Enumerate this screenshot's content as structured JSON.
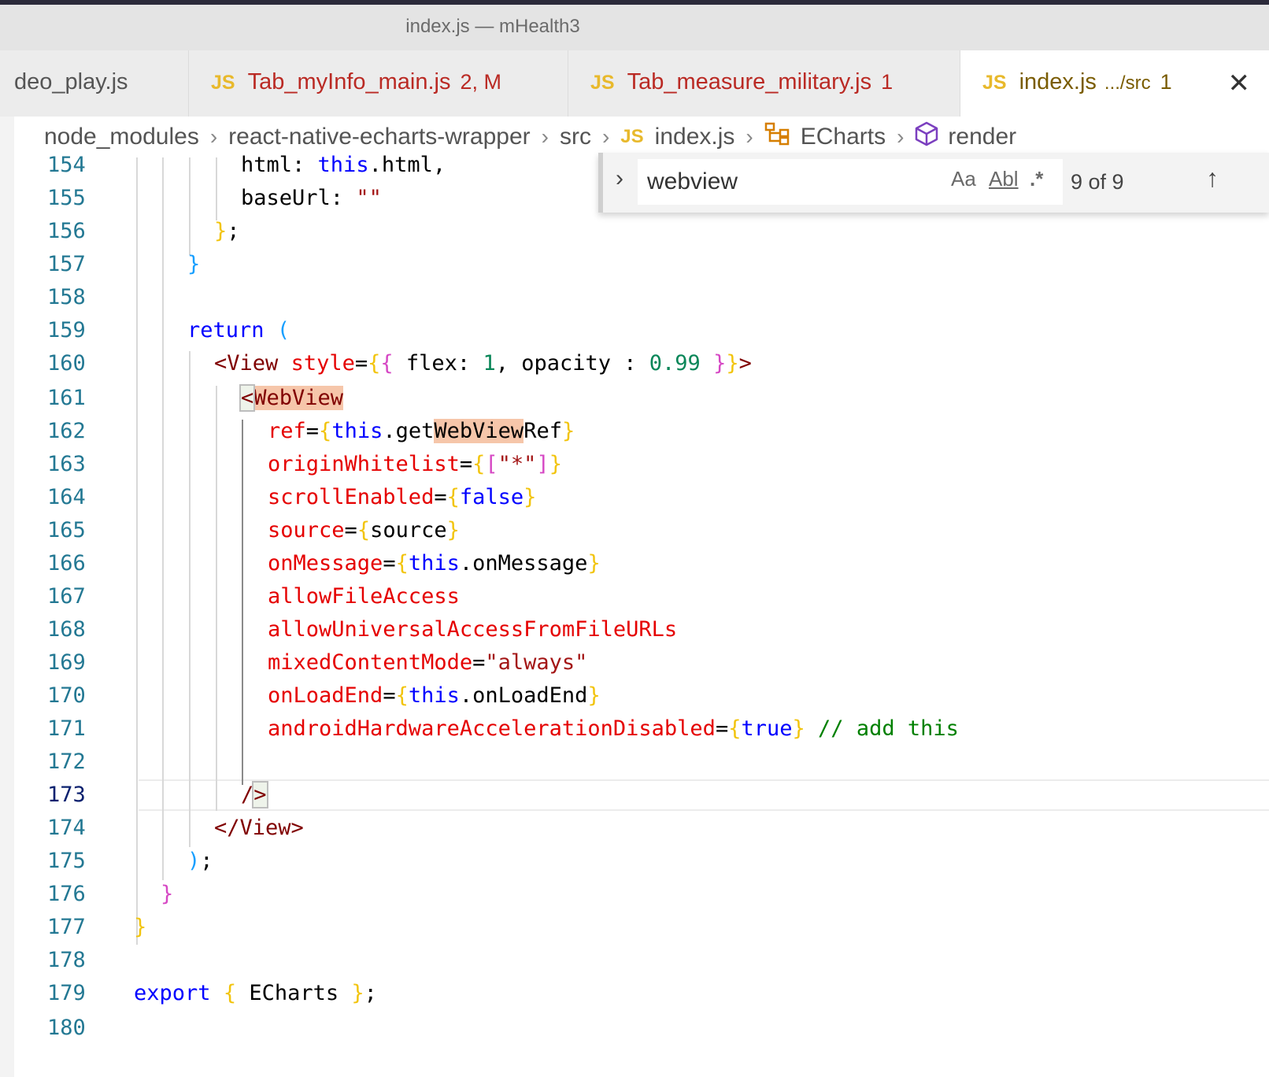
{
  "window": {
    "title": "index.js — mHealth3"
  },
  "tabs": [
    {
      "icon": "",
      "name": "deo_play.js",
      "badge": "",
      "path": ""
    },
    {
      "icon": "JS",
      "name": "Tab_myInfo_main.js",
      "badge": "2, M",
      "path": ""
    },
    {
      "icon": "JS",
      "name": "Tab_measure_military.js",
      "badge": "1",
      "path": ""
    },
    {
      "icon": "JS",
      "name": "index.js",
      "badge": "1",
      "path": ".../src"
    }
  ],
  "breadcrumb": {
    "items": [
      "node_modules",
      "react-native-echarts-wrapper",
      "src",
      "index.js",
      "ECharts",
      "render"
    ],
    "js_icon": "JS"
  },
  "find": {
    "value": "webview",
    "opt_case": "Aa",
    "opt_word": "Abl",
    "opt_regex": ".*",
    "count": "9 of 9"
  },
  "editor": {
    "current_line": "173",
    "line_numbers": [
      "154",
      "155",
      "156",
      "157",
      "158",
      "159",
      "160",
      "161",
      "162",
      "163",
      "164",
      "165",
      "166",
      "167",
      "168",
      "169",
      "170",
      "171",
      "172",
      "173",
      "174",
      "175",
      "176",
      "177",
      "178",
      "179",
      "180"
    ],
    "t": {
      "html": "html",
      "this": "this",
      "html_end": "html,",
      "baseUrl": "baseUrl: ",
      "empty_str": "\"\"",
      "return": "return",
      "lt": "<",
      "View": "View",
      "style": "style",
      "eq": "=",
      "flex": " flex: ",
      "one": "1",
      "opacity": ", opacity : ",
      "o99": "0.99",
      "gt": ">",
      "WebView": "WebView",
      "ref": "ref",
      "get": "get",
      "WebViewMatch": "WebView",
      "Ref": "Ref",
      "originWhitelist": "originWhitelist",
      "star": "\"*\"",
      "scrollEnabled": "scrollEnabled",
      "false": "false",
      "source": "source",
      "source_v": "source",
      "onMessage": "onMessage",
      "onMessage_v": "onMessage",
      "allowFileAccess": "allowFileAccess",
      "allowUniversal": "allowUniversalAccessFromFileURLs",
      "mixedContentMode": "mixedContentMode",
      "always": "\"always\"",
      "onLoadEnd": "onLoadEnd",
      "onLoadEnd_v": "onLoadEnd",
      "androidHW": "androidHardwareAccelerationDisabled",
      "true": "true",
      "comment": "// add this",
      "slash": "/",
      "closeView": "</View>",
      "semi": ";",
      "colon": ": ",
      "dot": ".",
      "comma": ",",
      "export": "export",
      "ECharts": " ECharts "
    }
  }
}
